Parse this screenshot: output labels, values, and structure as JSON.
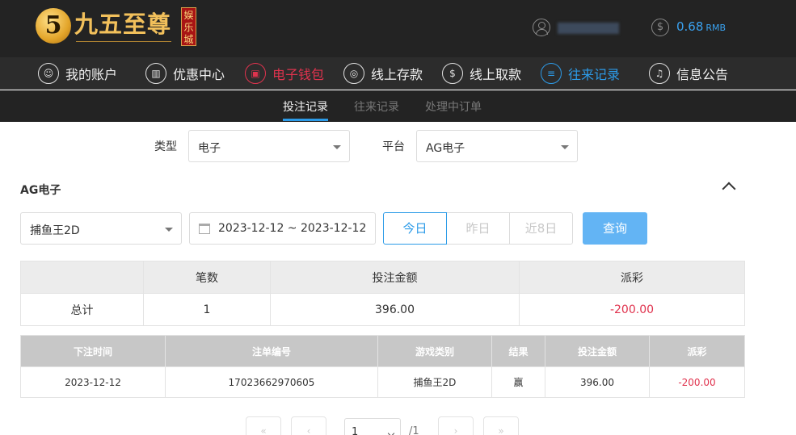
{
  "brand": {
    "name": "九五至尊",
    "seal": "娱乐城",
    "coin_char": "5"
  },
  "account": {
    "balance": "0.68",
    "currency": "RMB"
  },
  "nav": {
    "items": [
      {
        "label": "我的账户",
        "icon": "user-icon"
      },
      {
        "label": "优惠中心",
        "icon": "gift-icon"
      },
      {
        "label": "电子钱包",
        "icon": "wallet-icon"
      },
      {
        "label": "线上存款",
        "icon": "deposit-icon"
      },
      {
        "label": "线上取款",
        "icon": "withdraw-icon"
      },
      {
        "label": "往来记录",
        "icon": "records-icon"
      },
      {
        "label": "信息公告",
        "icon": "bell-icon"
      }
    ]
  },
  "subnav": {
    "tabs": [
      "投注记录",
      "往来记录",
      "处理中订单"
    ]
  },
  "filters": {
    "type_label": "类型",
    "type_value": "电子",
    "platform_label": "平台",
    "platform_value": "AG电子"
  },
  "section": {
    "title": "AG电子"
  },
  "search": {
    "game_value": "捕鱼王2D",
    "date_range": "2023-12-12 ~ 2023-12-12",
    "quick_ranges": [
      "今日",
      "昨日",
      "近8日"
    ],
    "query_label": "查询"
  },
  "summary": {
    "headers": [
      "",
      "笔数",
      "投注金额",
      "派彩"
    ],
    "row": [
      "总计",
      "1",
      "396.00",
      "-200.00"
    ]
  },
  "details": {
    "headers": [
      "下注时间",
      "注单编号",
      "游戏类别",
      "结果",
      "投注金额",
      "派彩"
    ],
    "rows": [
      [
        "2023-12-12",
        "17023662970605",
        "捕鱼王2D",
        "赢",
        "396.00",
        "-200.00"
      ]
    ]
  },
  "pager": {
    "current": "1",
    "total": "/1"
  },
  "colors": {
    "accent_blue": "#2c9be8",
    "accent_red": "#e0334e",
    "header_bg": "#232323"
  }
}
